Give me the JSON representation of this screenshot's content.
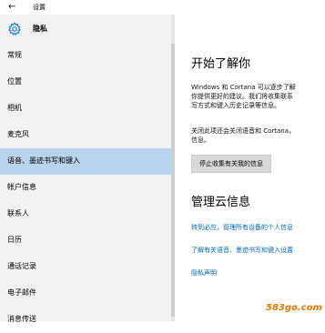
{
  "window": {
    "title": "设置",
    "back_icon": "back-arrow-icon"
  },
  "header": {
    "title": "隐私",
    "icon": "gear-icon",
    "icon_color": "#1e7fd0"
  },
  "sidebar": {
    "items": [
      {
        "label": "常规",
        "active": false
      },
      {
        "label": "位置",
        "active": false
      },
      {
        "label": "相机",
        "active": false
      },
      {
        "label": "麦克风",
        "active": false
      },
      {
        "label": "语音、墨迹书写和键入",
        "active": true
      },
      {
        "label": "帐户信息",
        "active": false
      },
      {
        "label": "联系人",
        "active": false
      },
      {
        "label": "日历",
        "active": false
      },
      {
        "label": "通话记录",
        "active": false
      },
      {
        "label": "电子邮件",
        "active": false
      },
      {
        "label": "消息传送",
        "active": false
      }
    ],
    "active_color": "#b9d4ea"
  },
  "main": {
    "section1": {
      "heading": "开始了解你",
      "line1": "Windows 和 Cortana 可以逐步了解",
      "line2": "你提供更好的建议。我们将收集联系",
      "line3": "写方式和键入历史记录等信息。",
      "line4": "关闭此项还会关闭语音和 Cortana，",
      "line5": "信息。",
      "button": "停止收集有关我的信息"
    },
    "section2": {
      "heading": "管理云信息",
      "link1": "转到必应，管理所有设备的个人信息",
      "link2": "了解有关语音、墨迹书写和键入设置",
      "link3": "隐私声明"
    },
    "link_color": "#0067b8"
  },
  "watermark": "583go.com"
}
